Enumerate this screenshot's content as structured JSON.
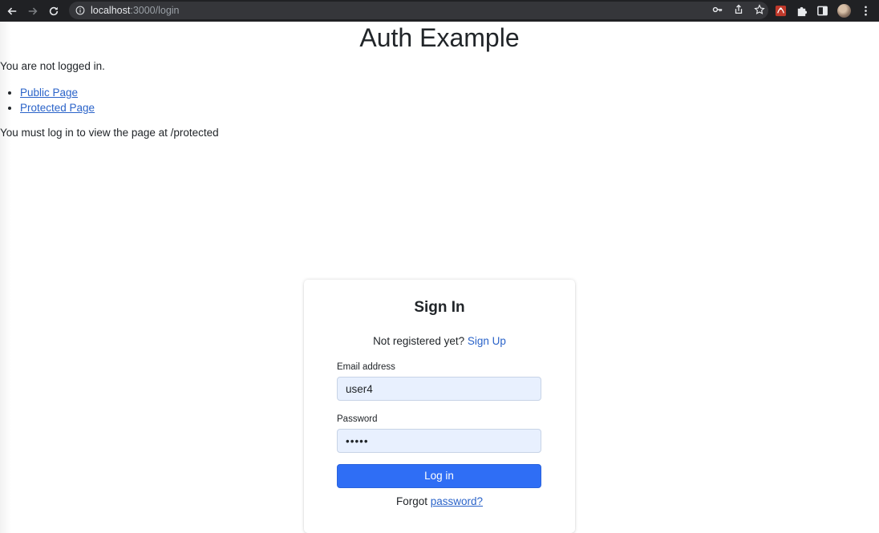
{
  "browser": {
    "url_host": "localhost",
    "url_rest": ":3000/login",
    "icons": [
      "back-arrow-icon",
      "forward-arrow-icon",
      "reload-icon",
      "info-icon",
      "key-icon",
      "share-icon",
      "star-icon",
      "extension-icon",
      "puzzle-icon",
      "sidebar-icon",
      "avatar",
      "more-vert-icon"
    ]
  },
  "header": {
    "title": "Auth Example"
  },
  "status": {
    "text": "You are not logged in."
  },
  "nav": {
    "items": [
      {
        "label": "Public Page"
      },
      {
        "label": "Protected Page"
      }
    ]
  },
  "message": {
    "text": "You must log in to view the page at /protected"
  },
  "signin": {
    "title": "Sign In",
    "register_prompt": "Not registered yet?",
    "register_link": "Sign Up",
    "email_label": "Email address",
    "email_value": "user4",
    "password_label": "Password",
    "password_value": "•••••",
    "login_button": "Log in",
    "forgot_prefix": "Forgot",
    "forgot_link": "password?"
  },
  "colors": {
    "accent": "#2f6ef5",
    "link": "#2a63c9",
    "input_bg": "#e8f0fe",
    "chrome_bg": "#202124"
  }
}
